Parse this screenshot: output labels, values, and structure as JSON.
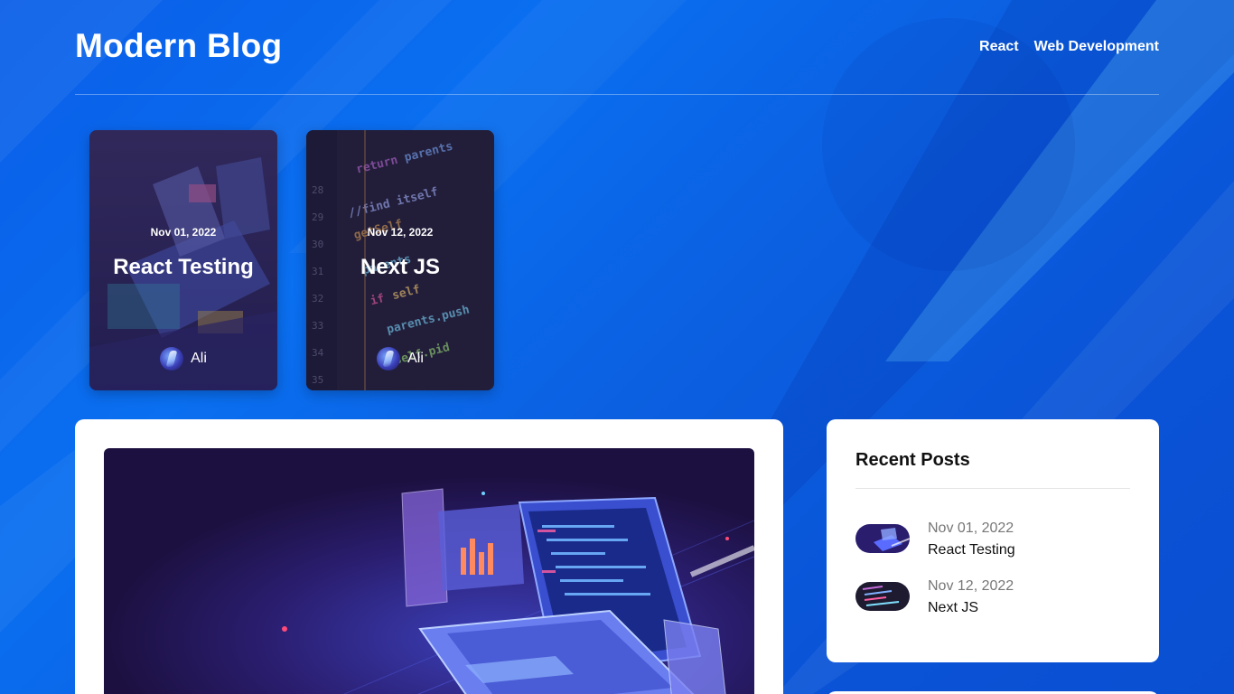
{
  "site": {
    "title": "Modern Blog"
  },
  "nav": [
    {
      "label": "React"
    },
    {
      "label": "Web Development"
    }
  ],
  "featured": [
    {
      "date": "Nov 01, 2022",
      "title": "React Testing",
      "author": "Ali",
      "image": "isometric-laptop-illustration"
    },
    {
      "date": "Nov 12, 2022",
      "title": "Next JS",
      "author": "Ali",
      "image": "code-editor-screenshot"
    }
  ],
  "main": {
    "hero_image": "isometric-laptop-illustration"
  },
  "sidebar": {
    "title": "Recent Posts",
    "posts": [
      {
        "date": "Nov 01, 2022",
        "title": "React Testing"
      },
      {
        "date": "Nov 12, 2022",
        "title": "Next JS"
      }
    ]
  },
  "colors": {
    "background": "#0a5ee8",
    "panel": "#ffffff",
    "text_dark": "#111111",
    "text_muted": "#777777"
  }
}
